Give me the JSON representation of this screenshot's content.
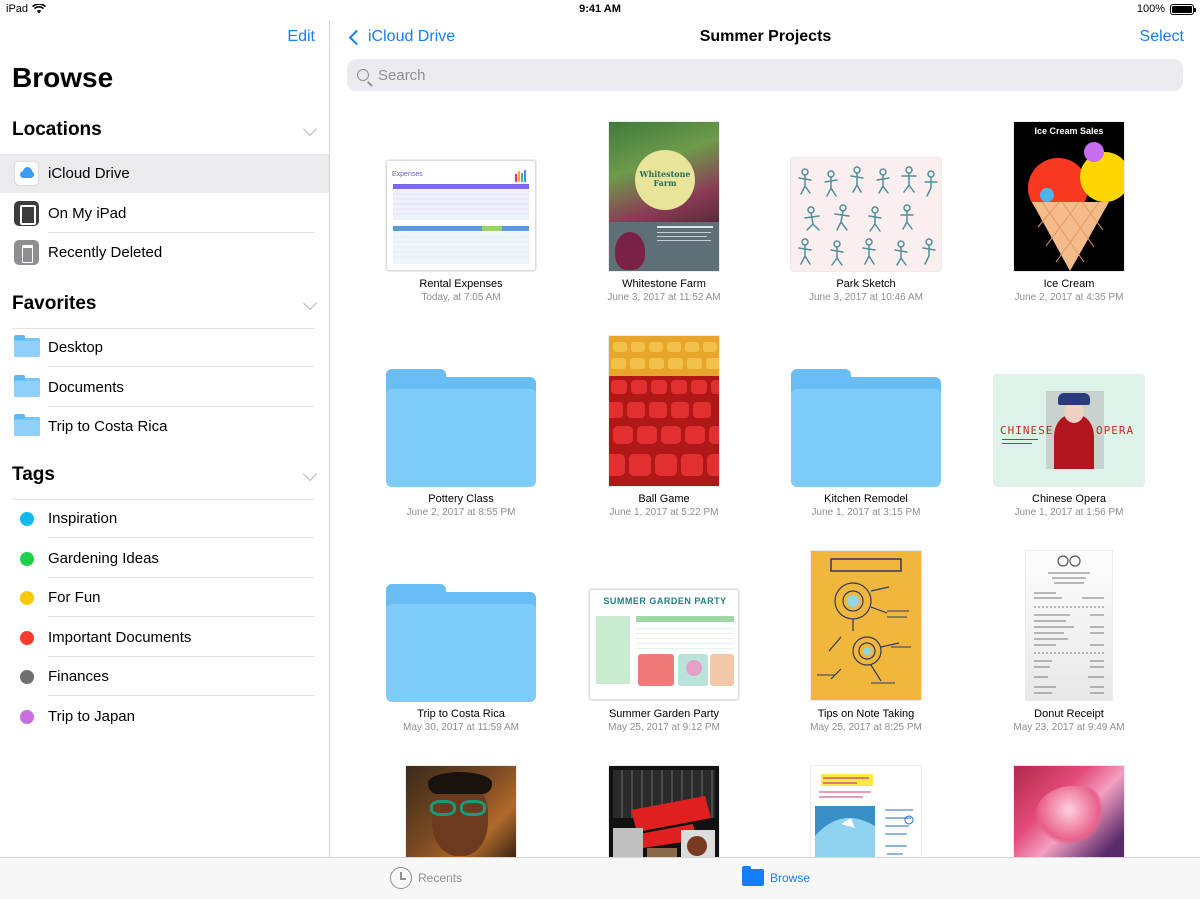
{
  "status": {
    "device": "iPad",
    "time": "9:41 AM",
    "battery": "100%"
  },
  "sidebar": {
    "edit_label": "Edit",
    "title": "Browse",
    "locations_header": "Locations",
    "locations": [
      {
        "label": "iCloud Drive",
        "icon": "cloud-icon",
        "selected": true
      },
      {
        "label": "On My iPad",
        "icon": "ipad-icon"
      },
      {
        "label": "Recently Deleted",
        "icon": "trash-icon"
      }
    ],
    "favorites_header": "Favorites",
    "favorites": [
      {
        "label": "Desktop",
        "icon": "folder-icon"
      },
      {
        "label": "Documents",
        "icon": "folder-icon"
      },
      {
        "label": "Trip to Costa Rica",
        "icon": "folder-icon"
      }
    ],
    "tags_header": "Tags",
    "tags": [
      {
        "label": "Inspiration",
        "color": "#10b9f0"
      },
      {
        "label": "Gardening Ideas",
        "color": "#1fd14a"
      },
      {
        "label": "For Fun",
        "color": "#fcc70a"
      },
      {
        "label": "Important Documents",
        "color": "#fb3a30"
      },
      {
        "label": "Finances",
        "color": "#6e6e73"
      },
      {
        "label": "Trip to Japan",
        "color": "#c86ee0"
      }
    ]
  },
  "nav": {
    "back_label": "iCloud Drive",
    "title": "Summer Projects",
    "select_label": "Select"
  },
  "search": {
    "placeholder": "Search"
  },
  "files": [
    {
      "name": "Rental Expenses",
      "date": "Today, at 7:05 AM",
      "kind": "spreadsheet",
      "thumb_text": "Expenses"
    },
    {
      "name": "Whitestone Farm",
      "date": "June 3, 2017 at 11:52 AM",
      "kind": "farm",
      "thumb_text": "Whitestone Farm"
    },
    {
      "name": "Park Sketch",
      "date": "June 3, 2017 at 10:46 AM",
      "kind": "sketch"
    },
    {
      "name": "Ice Cream",
      "date": "June 2, 2017 at 4:35 PM",
      "kind": "icecream",
      "thumb_text": "Ice Cream Sales"
    },
    {
      "name": "Pottery Class",
      "date": "June 2, 2017 at 8:55 PM",
      "kind": "folder"
    },
    {
      "name": "Ball Game",
      "date": "June 1, 2017 at 5:22 PM",
      "kind": "seats"
    },
    {
      "name": "Kitchen Remodel",
      "date": "June 1, 2017 at 3:15 PM",
      "kind": "folder"
    },
    {
      "name": "Chinese Opera",
      "date": "June 1, 2017 at 1:56 PM",
      "kind": "opera",
      "thumb_text_left": "CHINESE",
      "thumb_text_right": "OPERA"
    },
    {
      "name": "Trip to Costa Rica",
      "date": "May 30, 2017 at 11:59 AM",
      "kind": "folder"
    },
    {
      "name": "Summer Garden Party",
      "date": "May 25, 2017 at 9:12 PM",
      "kind": "party",
      "thumb_text": "SUMMER GARDEN PARTY"
    },
    {
      "name": "Tips on Note Taking",
      "date": "May 25, 2017 at 8:25 PM",
      "kind": "notes"
    },
    {
      "name": "Donut Receipt",
      "date": "May 23, 2017 at 9:49 AM",
      "kind": "receipt"
    },
    {
      "kind": "portrait"
    },
    {
      "kind": "restaurant"
    },
    {
      "kind": "surf"
    },
    {
      "kind": "flower"
    }
  ],
  "tabbar": {
    "recents_label": "Recents",
    "browse_label": "Browse"
  }
}
